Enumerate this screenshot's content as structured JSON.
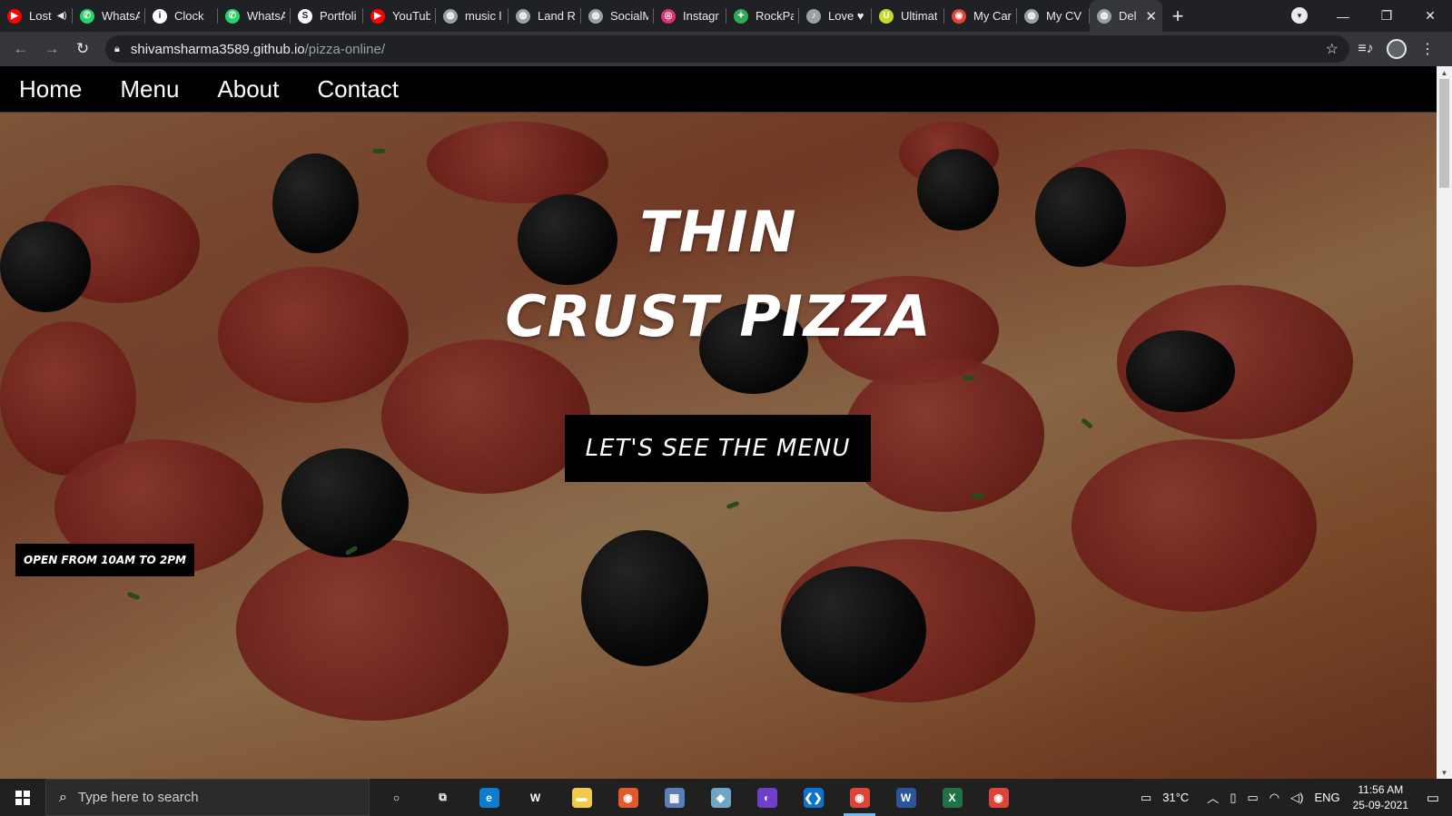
{
  "browser": {
    "tabs": [
      {
        "label": "Lost",
        "icon": "youtube-icon",
        "color": "#ff0000",
        "glyph": "▶",
        "extra": "◀)"
      },
      {
        "label": "WhatsA",
        "icon": "whatsapp-icon",
        "color": "#25d366",
        "glyph": "✆"
      },
      {
        "label": "Clock",
        "icon": "info-icon",
        "color": "#ffffff",
        "glyph": "i"
      },
      {
        "label": "WhatsA",
        "icon": "whatsapp-icon",
        "color": "#25d366",
        "glyph": "✆"
      },
      {
        "label": "Portfoli",
        "icon": "portfolio-icon",
        "color": "#ffffff",
        "glyph": "S"
      },
      {
        "label": "YouTub",
        "icon": "youtube-icon",
        "color": "#ff0000",
        "glyph": "▶"
      },
      {
        "label": "music l",
        "icon": "globe-icon",
        "color": "#9aa0a6",
        "glyph": "◍"
      },
      {
        "label": "Land Re",
        "icon": "globe-icon",
        "color": "#9aa0a6",
        "glyph": "◍"
      },
      {
        "label": "SocialM",
        "icon": "globe-icon",
        "color": "#9aa0a6",
        "glyph": "◍"
      },
      {
        "label": "Instagr",
        "icon": "instagram-icon",
        "color": "#e1306c",
        "glyph": "◎"
      },
      {
        "label": "RockPa",
        "icon": "rockpaper-icon",
        "color": "#34a853",
        "glyph": "✦"
      },
      {
        "label": "Love ♥",
        "icon": "love-icon",
        "color": "#9aa0a6",
        "glyph": "♪"
      },
      {
        "label": "Ultimat",
        "icon": "ultimate-icon",
        "color": "#c7d72f",
        "glyph": "U"
      },
      {
        "label": "My Car",
        "icon": "chrome-icon",
        "color": "#ea4335",
        "glyph": "◉"
      },
      {
        "label": "My CV",
        "icon": "globe-icon",
        "color": "#9aa0a6",
        "glyph": "◍"
      },
      {
        "label": "Del",
        "icon": "globe-icon",
        "color": "#9aa0a6",
        "glyph": "◍",
        "active": true
      }
    ],
    "new_tab": "+",
    "url_host": "shivamsharma3589.github.io",
    "url_path": "/pizza-online/"
  },
  "site": {
    "nav": [
      "Home",
      "Menu",
      "About",
      "Contact"
    ],
    "title_line1": "THIN",
    "title_line2": "CRUST PIZZA",
    "menu_button": "LET'S SEE THE MENU",
    "hours": "OPEN FROM 10AM TO 2PM"
  },
  "taskbar": {
    "search_placeholder": "Type here to search",
    "apps": [
      {
        "name": "cortana-icon",
        "glyph": "○",
        "color": "transparent"
      },
      {
        "name": "task-view-icon",
        "glyph": "⧉",
        "color": "transparent"
      },
      {
        "name": "edge-icon",
        "glyph": "e",
        "color": "#0f7bcf"
      },
      {
        "name": "w-app-icon",
        "glyph": "W",
        "color": "transparent"
      },
      {
        "name": "file-explorer-icon",
        "glyph": "▬",
        "color": "#f2c94c"
      },
      {
        "name": "media-player-icon",
        "glyph": "◉",
        "color": "#e05a2b"
      },
      {
        "name": "calculator-icon",
        "glyph": "▦",
        "color": "#5b7fb5"
      },
      {
        "name": "notes-icon",
        "glyph": "◆",
        "color": "#6fa6c8"
      },
      {
        "name": "github-icon",
        "glyph": "◐",
        "color": "#6e40c9"
      },
      {
        "name": "vscode-icon",
        "glyph": "❮❯",
        "color": "#0e73cc"
      },
      {
        "name": "chrome-icon",
        "glyph": "◉",
        "color": "#db4437",
        "active": true
      },
      {
        "name": "word-icon",
        "glyph": "W",
        "color": "#2b579a"
      },
      {
        "name": "excel-icon",
        "glyph": "X",
        "color": "#217346"
      },
      {
        "name": "chrome-icon-2",
        "glyph": "◉",
        "color": "#db4437"
      }
    ],
    "weather": "31°C",
    "language": "ENG",
    "time": "11:56 AM",
    "date": "25-09-2021"
  }
}
